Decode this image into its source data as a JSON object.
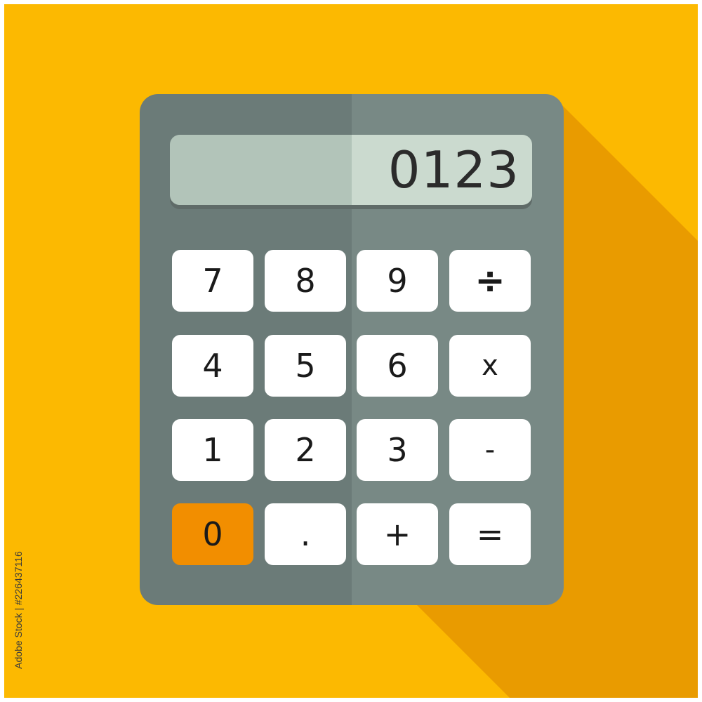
{
  "colors": {
    "background": "#fcb901",
    "long_shadow": "#e99b00",
    "body_left": "#6b7b78",
    "body_right": "#788985",
    "display_left": "#b2c4b9",
    "display_right": "#cbdacf",
    "key": "#ffffff",
    "zero_key_accent": "#f28e00"
  },
  "display": {
    "value": "0123"
  },
  "keypad": {
    "rows": [
      [
        {
          "label": "7",
          "name": "key-7"
        },
        {
          "label": "8",
          "name": "key-8"
        },
        {
          "label": "9",
          "name": "key-9"
        },
        {
          "label": "÷",
          "name": "key-divide"
        }
      ],
      [
        {
          "label": "4",
          "name": "key-4"
        },
        {
          "label": "5",
          "name": "key-5"
        },
        {
          "label": "6",
          "name": "key-6"
        },
        {
          "label": "x",
          "name": "key-multiply"
        }
      ],
      [
        {
          "label": "1",
          "name": "key-1"
        },
        {
          "label": "2",
          "name": "key-2"
        },
        {
          "label": "3",
          "name": "key-3"
        },
        {
          "label": "-",
          "name": "key-subtract"
        }
      ],
      [
        {
          "label": "0",
          "name": "key-0"
        },
        {
          "label": ".",
          "name": "key-decimal"
        },
        {
          "label": "+",
          "name": "key-add"
        },
        {
          "label": "=",
          "name": "key-equals"
        }
      ]
    ]
  },
  "credit": {
    "text": "Adobe Stock | #226437116"
  }
}
